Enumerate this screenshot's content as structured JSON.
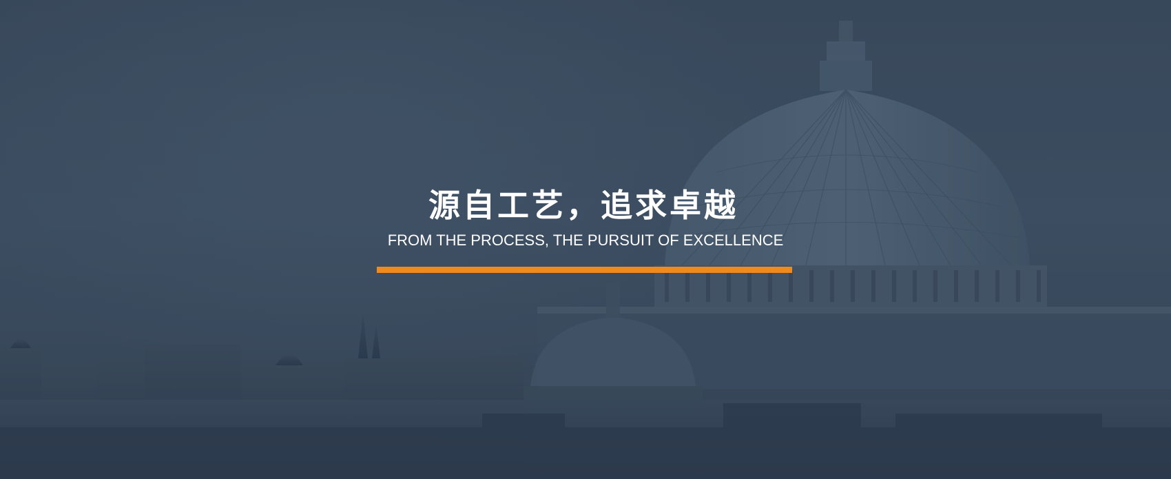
{
  "hero": {
    "title_cn": "源自工艺，追求卓越",
    "title_en": "FROM THE PROCESS, THE PURSUIT OF EXCELLENCE"
  },
  "colors": {
    "accent": "#f08a1c",
    "overlay": "#3d4d5f",
    "text": "#ffffff"
  }
}
